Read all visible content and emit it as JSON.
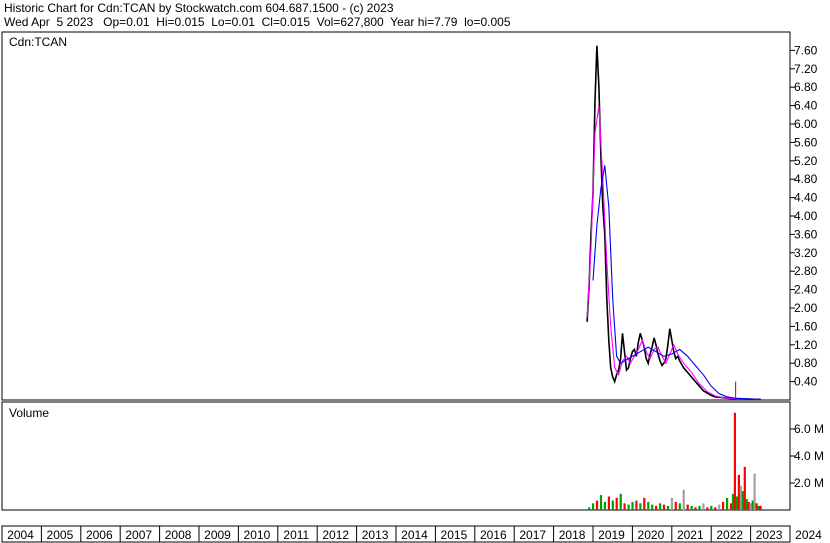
{
  "header": {
    "line1": "Historic Chart for Cdn:TCAN by Stockwatch.com 604.687.1500 - (c) 2023",
    "line2": "Wed Apr  5 2023   Op=0.01  Hi=0.015  Lo=0.01  Cl=0.015  Vol=627,800  Year hi=7.79  lo=0.005"
  },
  "chart_data": [
    {
      "type": "line",
      "panel_label": "Cdn:TCAN",
      "x_unit": "year",
      "xlim": [
        2004,
        2024
      ],
      "ylim": [
        0,
        8
      ],
      "y_ticks": [
        "0.40",
        "0.80",
        "1.20",
        "1.60",
        "2.00",
        "2.40",
        "2.80",
        "3.20",
        "3.60",
        "4.00",
        "4.40",
        "4.80",
        "5.20",
        "5.60",
        "6.00",
        "6.40",
        "6.80",
        "7.20",
        "7.60"
      ],
      "colors": {
        "price": "#000000",
        "ma_short": "#ff00ff",
        "ma_long": "#0000ff",
        "spike": "#ff0000"
      },
      "series": [
        {
          "role": "price",
          "x": [
            2018.85,
            2018.9,
            2018.95,
            2019.0,
            2019.05,
            2019.1,
            2019.15,
            2019.2,
            2019.25,
            2019.3,
            2019.35,
            2019.4,
            2019.45,
            2019.5,
            2019.55,
            2019.6,
            2019.65,
            2019.7,
            2019.75,
            2019.8,
            2019.85,
            2019.9,
            2019.95,
            2020.0,
            2020.05,
            2020.1,
            2020.15,
            2020.2,
            2020.25,
            2020.3,
            2020.35,
            2020.4,
            2020.45,
            2020.5,
            2020.55,
            2020.6,
            2020.65,
            2020.7,
            2020.75,
            2020.8,
            2020.85,
            2020.9,
            2020.95,
            2021.0,
            2021.05,
            2021.1,
            2021.15,
            2021.2,
            2021.3,
            2021.4,
            2021.5,
            2021.6,
            2021.7,
            2021.8,
            2021.9,
            2022.0,
            2022.1,
            2022.2,
            2022.3,
            2022.4,
            2022.5,
            2022.6,
            2022.7,
            2022.8,
            2022.9,
            2023.0,
            2023.1,
            2023.2,
            2023.26
          ],
          "y": [
            1.7,
            2.5,
            3.6,
            4.5,
            6.5,
            7.7,
            6.8,
            5.3,
            4.2,
            3.6,
            2.2,
            1.3,
            0.7,
            0.5,
            0.4,
            0.55,
            0.65,
            0.9,
            1.45,
            1.05,
            0.65,
            0.7,
            0.9,
            1.05,
            1.1,
            0.95,
            1.25,
            1.45,
            1.3,
            1.15,
            0.9,
            0.8,
            1.0,
            1.15,
            1.35,
            1.2,
            1.0,
            0.85,
            0.75,
            0.8,
            0.9,
            1.2,
            1.55,
            1.3,
            1.05,
            0.9,
            0.95,
            0.85,
            0.7,
            0.6,
            0.5,
            0.4,
            0.3,
            0.2,
            0.15,
            0.1,
            0.07,
            0.06,
            0.05,
            0.04,
            0.03,
            0.03,
            0.02,
            0.02,
            0.02,
            0.02,
            0.015,
            0.015,
            0.015
          ]
        },
        {
          "role": "ma_short",
          "x": [
            2018.85,
            2018.95,
            2019.05,
            2019.15,
            2019.25,
            2019.35,
            2019.45,
            2019.55,
            2019.65,
            2019.75,
            2019.85,
            2019.95,
            2020.05,
            2020.15,
            2020.25,
            2020.35,
            2020.45,
            2020.55,
            2020.65,
            2020.75,
            2020.85,
            2020.95,
            2021.05,
            2021.15,
            2021.3,
            2021.5,
            2021.7,
            2021.9,
            2022.1,
            2022.3,
            2022.5,
            2022.7,
            2022.9,
            2023.1,
            2023.26
          ],
          "y": [
            1.8,
            3.3,
            5.8,
            6.4,
            4.8,
            3.0,
            1.6,
            0.7,
            0.55,
            0.85,
            0.95,
            0.8,
            0.95,
            1.1,
            1.3,
            1.05,
            0.9,
            1.1,
            1.15,
            0.95,
            0.8,
            1.0,
            1.2,
            1.0,
            0.8,
            0.6,
            0.35,
            0.18,
            0.09,
            0.05,
            0.03,
            0.02,
            0.02,
            0.016,
            0.015
          ]
        },
        {
          "role": "ma_long",
          "x": [
            2019.0,
            2019.1,
            2019.2,
            2019.3,
            2019.4,
            2019.5,
            2019.6,
            2019.7,
            2019.8,
            2019.9,
            2020.0,
            2020.2,
            2020.4,
            2020.6,
            2020.8,
            2021.0,
            2021.2,
            2021.4,
            2021.6,
            2021.8,
            2022.0,
            2022.2,
            2022.4,
            2022.6,
            2022.8,
            2023.0,
            2023.26
          ],
          "y": [
            2.6,
            3.8,
            4.6,
            5.1,
            4.2,
            2.2,
            0.95,
            0.8,
            0.85,
            0.9,
            0.95,
            1.05,
            1.15,
            1.05,
            0.95,
            1.0,
            1.1,
            0.95,
            0.75,
            0.55,
            0.3,
            0.14,
            0.07,
            0.04,
            0.03,
            0.02,
            0.018
          ]
        },
        {
          "role": "spike",
          "x": [
            2022.62,
            2022.62
          ],
          "y": [
            0.05,
            0.4
          ]
        }
      ]
    },
    {
      "type": "bar",
      "panel_label": "Volume",
      "x_unit": "year",
      "xlim": [
        2004,
        2024
      ],
      "ylim": [
        0,
        8000000
      ],
      "y_ticks": [
        "2.0 M",
        "4.0 M",
        "6.0 M"
      ],
      "colors": {
        "up": "#00a000",
        "down": "#ff0000",
        "flat": "#a0a0a0"
      },
      "x": [
        2018.9,
        2019.0,
        2019.1,
        2019.2,
        2019.3,
        2019.4,
        2019.5,
        2019.6,
        2019.7,
        2019.8,
        2019.9,
        2020.0,
        2020.1,
        2020.2,
        2020.3,
        2020.4,
        2020.5,
        2020.6,
        2020.7,
        2020.8,
        2020.9,
        2021.0,
        2021.1,
        2021.2,
        2021.3,
        2021.4,
        2021.5,
        2021.6,
        2021.7,
        2021.8,
        2021.9,
        2022.0,
        2022.1,
        2022.2,
        2022.3,
        2022.4,
        2022.5,
        2022.55,
        2022.6,
        2022.65,
        2022.7,
        2022.75,
        2022.8,
        2022.85,
        2022.9,
        2022.95,
        2023.0,
        2023.05,
        2023.1,
        2023.15,
        2023.2,
        2023.25
      ],
      "values": [
        200000,
        500000,
        700000,
        1100000,
        600000,
        1000000,
        700000,
        900000,
        1200000,
        500000,
        400000,
        600000,
        700000,
        500000,
        900000,
        600000,
        400000,
        300000,
        500000,
        400000,
        300000,
        900000,
        600000,
        500000,
        1500000,
        400000,
        300000,
        200000,
        300000,
        500000,
        200000,
        300000,
        200000,
        400000,
        600000,
        900000,
        500000,
        1200000,
        7200000,
        1000000,
        2600000,
        1800000,
        1400000,
        3200000,
        800000,
        600000,
        500000,
        700000,
        2700000,
        500000,
        300000,
        300000
      ],
      "direction": [
        "up",
        "up",
        "down",
        "up",
        "up",
        "down",
        "up",
        "down",
        "up",
        "down",
        "up",
        "up",
        "down",
        "up",
        "down",
        "up",
        "up",
        "down",
        "up",
        "down",
        "up",
        "flat",
        "down",
        "up",
        "flat",
        "down",
        "up",
        "down",
        "up",
        "flat",
        "down",
        "up",
        "down",
        "flat",
        "down",
        "up",
        "down",
        "up",
        "down",
        "up",
        "down",
        "flat",
        "up",
        "down",
        "up",
        "down",
        "flat",
        "up",
        "flat",
        "down",
        "up",
        "down"
      ]
    }
  ],
  "x_axis": {
    "tick_labels": [
      "2004",
      "2005",
      "2006",
      "2007",
      "2008",
      "2009",
      "2010",
      "2011",
      "2012",
      "2013",
      "2014",
      "2015",
      "2016",
      "2017",
      "2018",
      "2019",
      "2020",
      "2021",
      "2022",
      "2023",
      "2024"
    ]
  }
}
